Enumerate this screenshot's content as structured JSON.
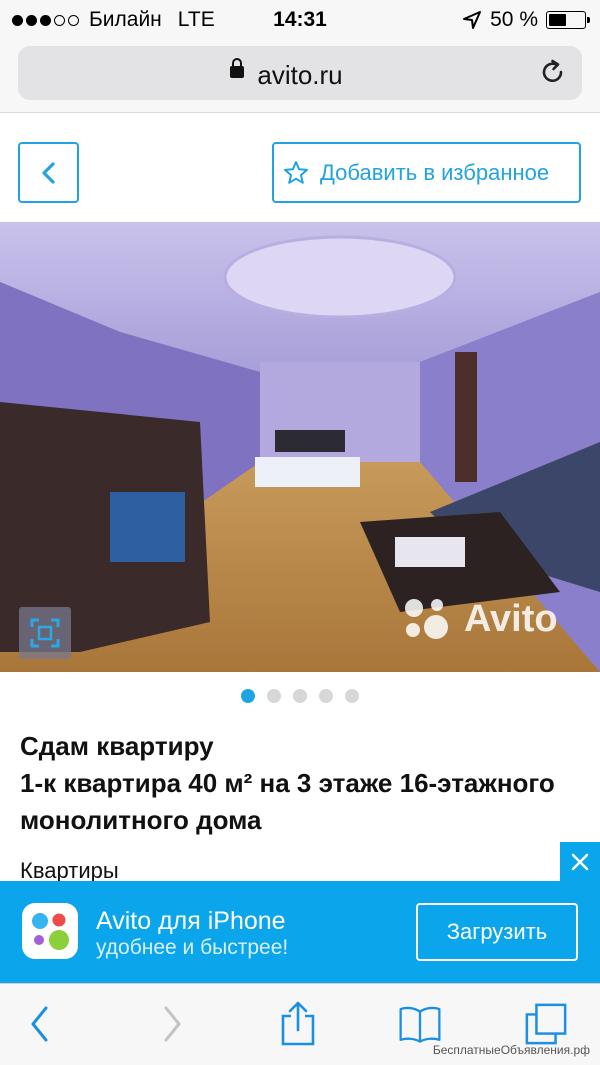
{
  "status_bar": {
    "carrier": "Билайн",
    "network": "LTE",
    "time": "14:31",
    "battery_text": "50 %",
    "battery_level": 0.5,
    "signal_bars_filled": 3,
    "signal_bars_total": 5
  },
  "browser": {
    "domain": "avito.ru",
    "lock_icon": "lock-icon",
    "reload_icon": "reload-icon"
  },
  "actions": {
    "back_icon": "chevron-left-icon",
    "favorite_label": "Добавить в избранное",
    "favorite_icon": "star-outline-icon"
  },
  "gallery": {
    "watermark": "Avito",
    "total_images": 5,
    "active_index": 0,
    "zoom_icon": "fullscreen-icon"
  },
  "listing": {
    "title_line1": "Сдам квартиру",
    "title_line2": "1-к квартира 40 м² на 3 этаже 16-этажного монолитного дома",
    "category": "Квартиры"
  },
  "app_banner": {
    "title": "Avito для iPhone",
    "subtitle": "удобнее и быстрее!",
    "install_label": "Загрузить",
    "close_icon": "close-icon"
  },
  "toolbar": {
    "back_icon": "chevron-left-icon",
    "forward_icon": "chevron-right-icon",
    "share_icon": "share-icon",
    "bookmarks_icon": "book-icon",
    "tabs_icon": "tabs-icon"
  },
  "footer": {
    "credit": "БесплатныеОбъявления.рф"
  },
  "colors": {
    "accent": "#23a3dd",
    "banner": "#0aa5ea",
    "dot_active": "#1da4e2"
  }
}
